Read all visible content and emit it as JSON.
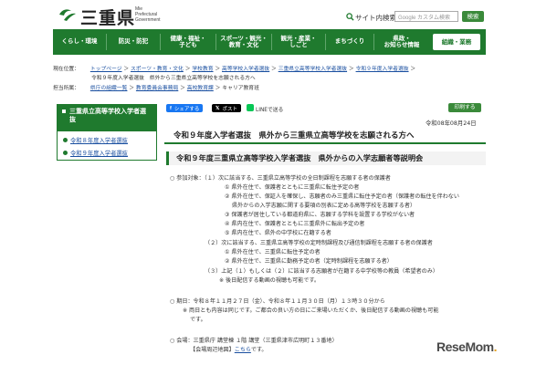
{
  "header": {
    "logo_text": "三重県",
    "logo_sub": [
      "Mie",
      "Prefectural",
      "Government"
    ],
    "search_label": "サイト内検索",
    "search_placeholder": "Google カスタム検索",
    "search_button": "検索"
  },
  "nav": {
    "items": [
      "くらし・環境",
      "防災・防犯",
      "健康・福祉・\n子ども",
      "スポーツ・観光・\n教育・文化",
      "観光・産業・\nしごと",
      "まちづくり",
      "県政・\nお知らせ情報"
    ],
    "last": "組織・業務"
  },
  "breadcrumb": {
    "row1_head": "現在位置：",
    "row1": [
      "トップページ",
      "スポーツ・教育・文化",
      "学校教育",
      "高等学校入学者選抜",
      "三重県立高等学校入学者選抜",
      "令和９年度入学者選抜"
    ],
    "row2": "令和９年度入学者選抜　県外から三重県立高等学校を志願される方へ",
    "row3_head": "担当所属：",
    "row3": [
      "県庁の組織一覧",
      "教育委員会事務局",
      "高校教育課"
    ],
    "row3_tail": "キャリア教育班"
  },
  "sidebar": {
    "title": "三重県立高等学校入学者選抜",
    "items": [
      "令和８年度入学者選抜",
      "令和９年度入学者選抜"
    ]
  },
  "share": {
    "facebook": "シェアする",
    "x": "ポスト",
    "line": "LINEで送る",
    "print": "印刷する"
  },
  "date": "令和08年08月24日",
  "title": "令和９年度入学者選抜　県外から三重県立高等学校を志願される方へ",
  "section_title": "令和９年度三重県立高等学校入学者選抜　県外からの入学志願者等説明会",
  "body": {
    "l1": "○ 参加対象：（１）次に該当する、三重県立高等学校の全日制課程を志願する者の保護者",
    "l2": "① 県外在住で、保護者とともに三重県に転住予定の者",
    "l3": "② 県外在住で、保証人を確保し、志願者のみ三重県に転住予定の者（保護者の転住を伴わない",
    "l4": "県外からの入学志願に関する要項の別表に定める高等学校を志願する者）",
    "l5": "③ 保護者が居住している都道府県に、志願する学科を設置する学校がない者",
    "l6": "④ 県内在住で、保護者とともに三重県外に転出予定の者",
    "l7": "⑤ 県内在住で、県外の中学校に在籍する者",
    "l8": "（２）次に該当する、三重県立高等学校の定時制課程及び通信制課程を志願する者の保護者",
    "l9": "① 県外在住で、三重県に転住予定の者",
    "l10": "② 県外在住で、三重県に勤務予定の者（定時制課程を志願する者）",
    "l11": "（３）上記（１）もしくは（２）に該当する志願者が在籍する中学校等の教員（希望者のみ）",
    "l12": "※ 後日配信する動画の視聴も可能です。",
    "l13": "○ 期日：令和８年１１月２７日（金）、令和８年１１月３０日（月）１３時３０分から",
    "l14": "※ 両日とも内容は同じです。ご都合の良い方の日にご来場いただくか、後日配信する動画の視聴も可能",
    "l15": "です。",
    "l16": "○ 会場：三重県庁 講堂棟 １階 講堂（三重県津市広明町１３番地）",
    "l17_prefix": "【会場周辺地図】",
    "l17_link": "こちら",
    "l17_suffix": "です。"
  },
  "watermark": {
    "main": "ReseMom",
    "dot": "."
  }
}
